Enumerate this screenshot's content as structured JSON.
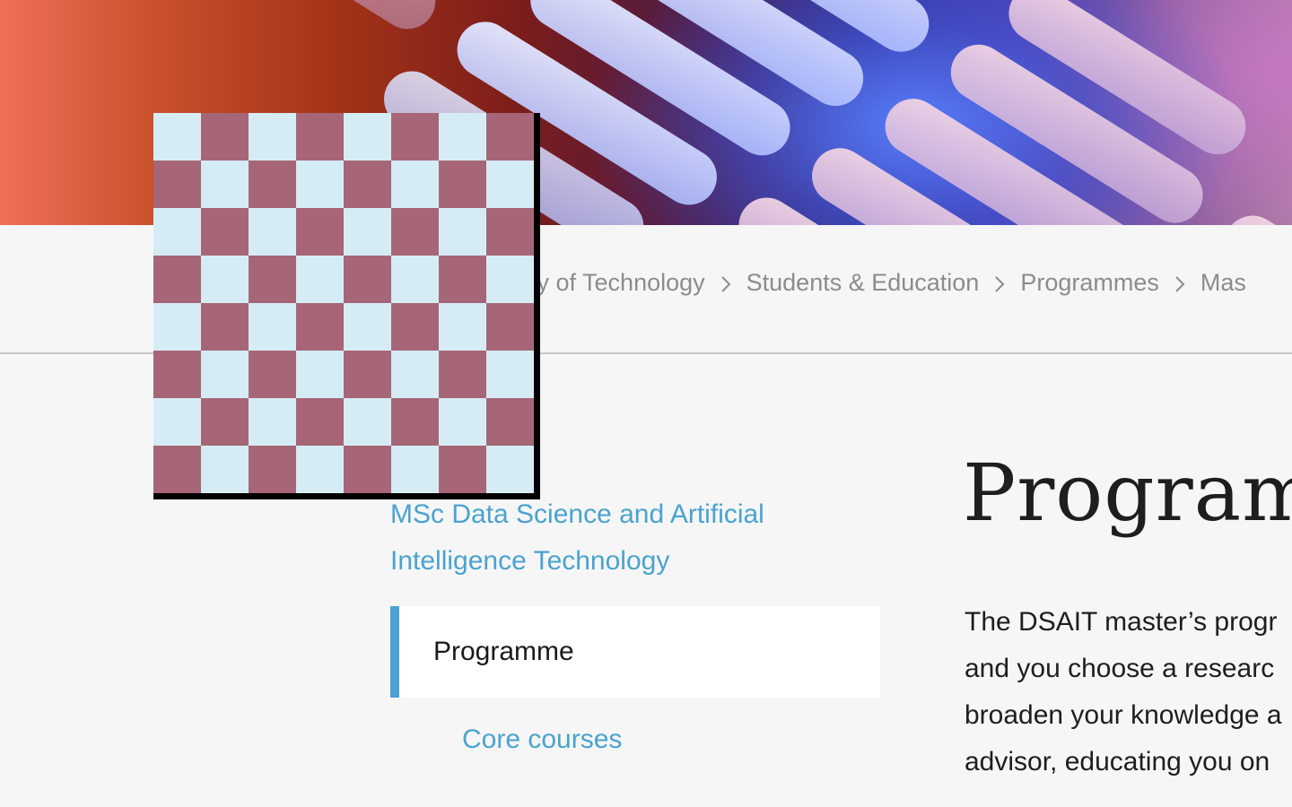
{
  "breadcrumb": {
    "items": [
      "ity of Technology",
      "Students & Education",
      "Programmes",
      "Mas"
    ]
  },
  "sidebar": {
    "title": "MSc Data Science and Artificial Intelligence Technology",
    "title_lines": [
      "MSc Data Science and Artificial",
      "Intelligence Technology"
    ],
    "active_item": "Programme",
    "items": [
      "Core courses"
    ]
  },
  "main": {
    "title": "Programm",
    "paragraph_lines": [
      "The DSAIT master’s progr",
      "and you choose a researc",
      "broaden your knowledge a",
      "advisor, educating you on"
    ]
  },
  "colors": {
    "accent": "#4aa3d0",
    "background": "#f6f6f6",
    "checker_light": "#d6ecf5",
    "checker_dark": "#a66677"
  },
  "icons": {
    "breadcrumb_separator": "chevron-right-icon"
  }
}
